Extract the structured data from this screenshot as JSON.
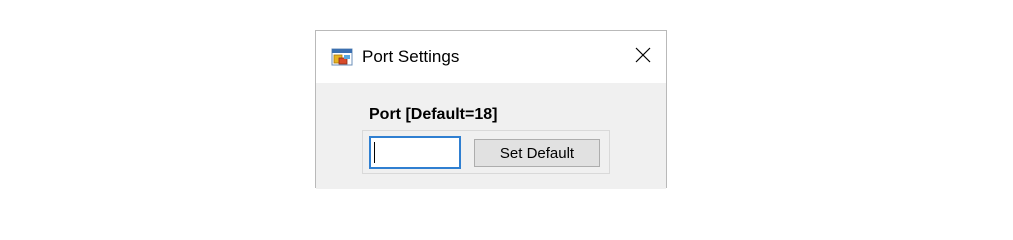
{
  "window": {
    "title": "Port Settings",
    "icon": "app-window-icon",
    "close_icon": "close-icon"
  },
  "form": {
    "port_label": "Port [Default=18]",
    "port_value": "",
    "set_default_label": "Set Default"
  },
  "colors": {
    "dialog_background": "#f0f0f0",
    "titlebar_background": "#ffffff",
    "input_focus_border": "#2f7fd1",
    "button_background": "#e1e1e1",
    "button_border": "#adadad"
  }
}
